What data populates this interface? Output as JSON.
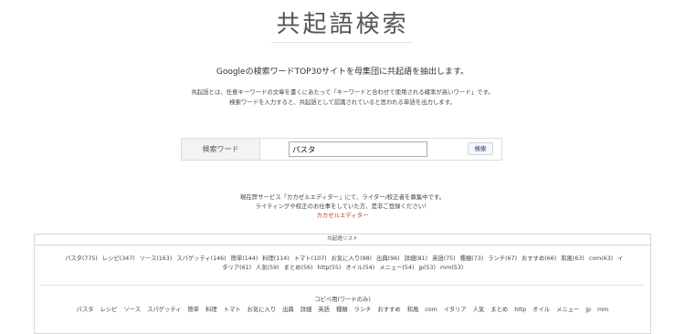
{
  "header": {
    "logo_text": "共起語検索"
  },
  "intro": {
    "lead": "Googleの検索ワードTOP30サイトを母集団に共起語を抽出します。",
    "desc_line1": "共起語とは、任意キーワードの文章を書くにあたって「キーワードと合わせて使用される確率が高いワード」です。",
    "desc_line2": "検索ワードを入力すると、共起語として認識されていると思われる単語を出力します。"
  },
  "search": {
    "label": "検索ワード",
    "value": "パスタ",
    "button_label": "検索"
  },
  "notice": {
    "line1": "現在弊サービス「カカゼルエディター」にて、ライター/校正者を募集中です。",
    "line2": "ライティングや校正のお仕事をしていた方、是非ご登録ください！",
    "link_text": "カカゼルエディター"
  },
  "results": {
    "header": "共起語リスト",
    "words": [
      "パスタ(775)",
      "レシピ(347)",
      "ソース(163)",
      "スパゲッティ(146)",
      "簡単(144)",
      "料理(114)",
      "トマト(107)",
      "お気に入り(98)",
      "出典(96)",
      "詳細(81)",
      "英語(75)",
      "種類(73)",
      "ランチ(67)",
      "おすすめ(66)",
      "和風(63)",
      "com(63)",
      "イタリア(61)",
      "人気(59)",
      "まとめ(56)",
      "http(55)",
      "オイル(54)",
      "メニュー(54)",
      "jp(53)",
      "mm(53)"
    ],
    "copy_label": "コピペ用(ワードのみ)",
    "copy_words": [
      "パスタ",
      "レシピ",
      "ソース",
      "スパゲッティ",
      "簡単",
      "料理",
      "トマト",
      "お気に入り",
      "出典",
      "詳細",
      "英語",
      "種類",
      "ランチ",
      "おすすめ",
      "和風",
      "com",
      "イタリア",
      "人気",
      "まとめ",
      "http",
      "オイル",
      "メニュー",
      "jp",
      "mm"
    ]
  },
  "colors": {
    "link": "#c0392b",
    "border": "#dcdcdc"
  }
}
